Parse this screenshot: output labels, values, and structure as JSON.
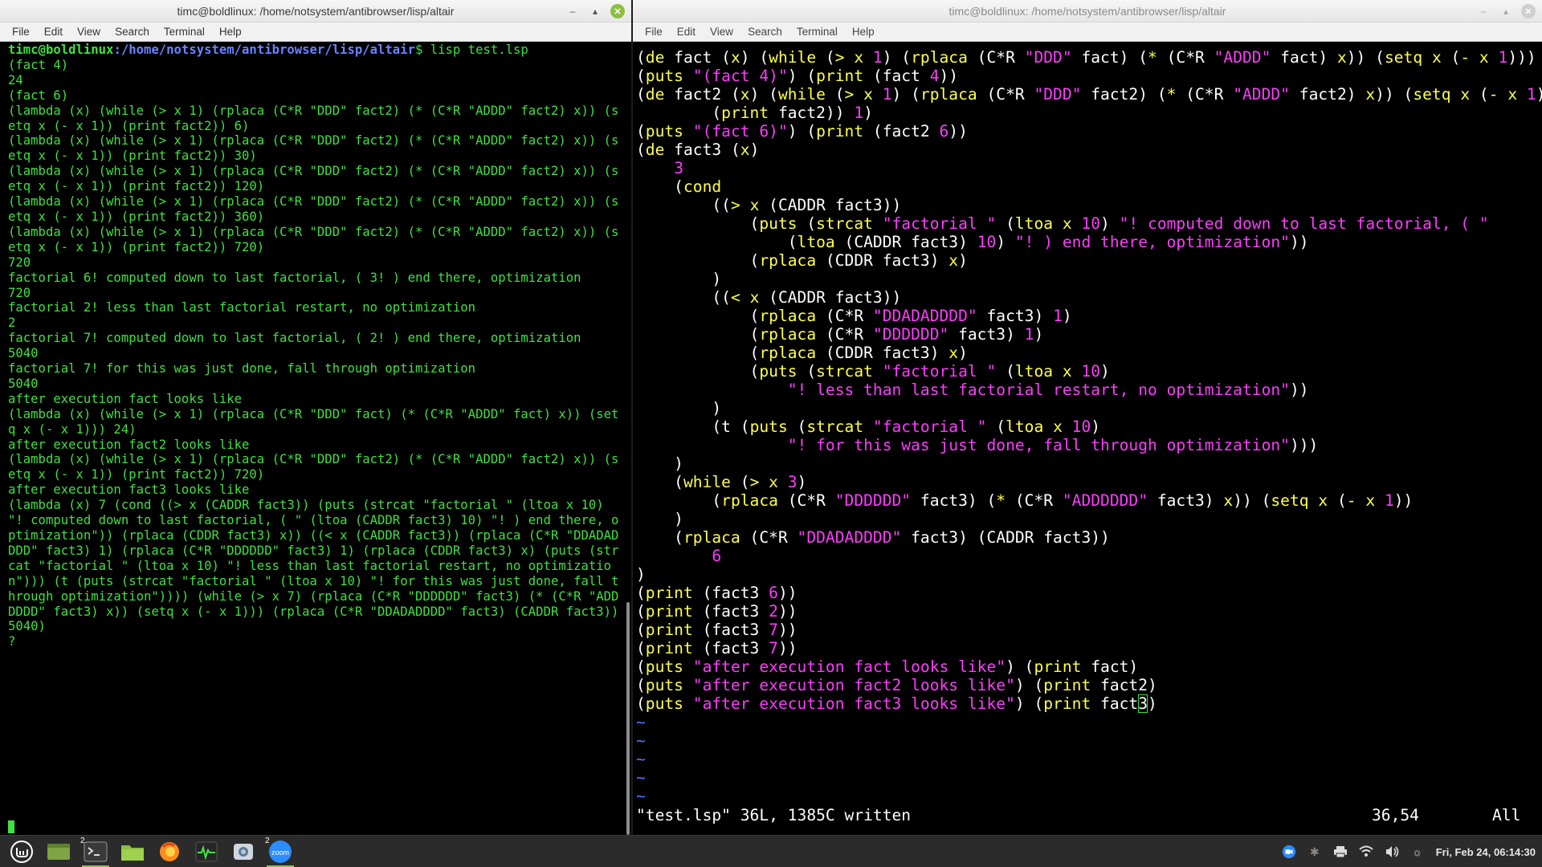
{
  "left_window": {
    "title": "timc@boldlinux: /home/notsystem/antibrowser/lisp/altair",
    "menu": [
      "File",
      "Edit",
      "View",
      "Search",
      "Terminal",
      "Help"
    ],
    "prompt_user": "timc@boldlinux",
    "prompt_path": ":/home/notsystem/antibrowser/lisp/altair",
    "prompt_cmd": "$ lisp test.lsp",
    "output": "(fact 4)\n24\n(fact 6)\n(lambda (x) (while (> x 1) (rplaca (C*R \"DDD\" fact2) (* (C*R \"ADDD\" fact2) x)) (setq x (- x 1)) (print fact2)) 6)\n(lambda (x) (while (> x 1) (rplaca (C*R \"DDD\" fact2) (* (C*R \"ADDD\" fact2) x)) (setq x (- x 1)) (print fact2)) 30)\n(lambda (x) (while (> x 1) (rplaca (C*R \"DDD\" fact2) (* (C*R \"ADDD\" fact2) x)) (setq x (- x 1)) (print fact2)) 120)\n(lambda (x) (while (> x 1) (rplaca (C*R \"DDD\" fact2) (* (C*R \"ADDD\" fact2) x)) (setq x (- x 1)) (print fact2)) 360)\n(lambda (x) (while (> x 1) (rplaca (C*R \"DDD\" fact2) (* (C*R \"ADDD\" fact2) x)) (setq x (- x 1)) (print fact2)) 720)\n720\nfactorial 6! computed down to last factorial, ( 3! ) end there, optimization\n720\nfactorial 2! less than last factorial restart, no optimization\n2\nfactorial 7! computed down to last factorial, ( 2! ) end there, optimization\n5040\nfactorial 7! for this was just done, fall through optimization\n5040\nafter execution fact looks like\n(lambda (x) (while (> x 1) (rplaca (C*R \"DDD\" fact) (* (C*R \"ADDD\" fact) x)) (setq x (- x 1))) 24)\nafter execution fact2 looks like\n(lambda (x) (while (> x 1) (rplaca (C*R \"DDD\" fact2) (* (C*R \"ADDD\" fact2) x)) (setq x (- x 1)) (print fact2)) 720)\nafter execution fact3 looks like\n(lambda (x) 7 (cond ((> x (CADDR fact3)) (puts (strcat \"factorial \" (ltoa x 10) \"! computed down to last factorial, ( \" (ltoa (CADDR fact3) 10) \"! ) end there, optimization\")) (rplaca (CDDR fact3) x)) ((< x (CADDR fact3)) (rplaca (C*R \"DDADADDDD\" fact3) 1) (rplaca (C*R \"DDDDDD\" fact3) 1) (rplaca (CDDR fact3) x) (puts (strcat \"factorial \" (ltoa x 10) \"! less than last factorial restart, no optimization\"))) (t (puts (strcat \"factorial \" (ltoa x 10) \"! for this was just done, fall through optimization\")))) (while (> x 7) (rplaca (C*R \"DDDDDD\" fact3) (* (C*R \"ADDDDDD\" fact3) x)) (setq x (- x 1))) (rplaca (C*R \"DDADADDDD\" fact3) (CADDR fact3)) 5040)\n?"
  },
  "right_window": {
    "title": "timc@boldlinux: /home/notsystem/antibrowser/lisp/altair",
    "menu": [
      "File",
      "Edit",
      "View",
      "Search",
      "Terminal",
      "Help"
    ],
    "status_file": "\"test.lsp\" 36L, 1385C written",
    "status_pos": "36,54",
    "status_all": "All"
  },
  "taskbar": {
    "terminal_badge": "2",
    "zoom_badge": "2",
    "zoom_label": "zoom",
    "clock": "Fri, Feb 24, 06:14:30"
  },
  "colors": {
    "terminal_green": "#3fe13f",
    "vim_keyword": "#ffff4a",
    "vim_string": "#ff3bff",
    "vim_tilde": "#4a7dff",
    "mint_green": "#8bbf43"
  }
}
